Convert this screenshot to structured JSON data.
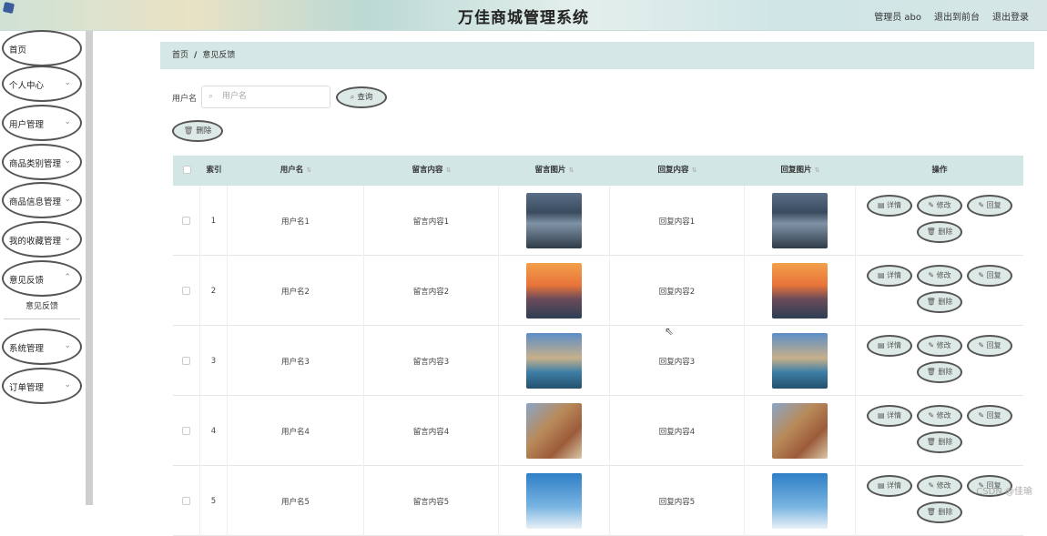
{
  "header": {
    "title": "万佳商城管理系统",
    "user": "管理员 abo",
    "back_to_front": "退出到前台",
    "logout": "退出登录"
  },
  "sidebar": {
    "items": [
      {
        "label": "首页",
        "chevron": false
      },
      {
        "label": "个人中心",
        "chevron": true
      },
      {
        "label": "用户管理",
        "chevron": true
      },
      {
        "label": "商品类别管理",
        "chevron": true
      },
      {
        "label": "商品信息管理",
        "chevron": true
      },
      {
        "label": "我的收藏管理",
        "chevron": true
      },
      {
        "label": "意见反馈",
        "chevron": true,
        "expanded": true
      },
      {
        "label": "系统管理",
        "chevron": true
      },
      {
        "label": "订单管理",
        "chevron": true
      }
    ],
    "sub_item": "意见反馈"
  },
  "breadcrumb": {
    "home": "首页",
    "sep": "/",
    "current": "意见反馈"
  },
  "search": {
    "label": "用户名",
    "placeholder": "用户名",
    "query_button": "查询",
    "delete_button": "删除"
  },
  "table": {
    "headers": [
      "索引",
      "用户名",
      "留言内容",
      "留言图片",
      "回复内容",
      "回复图片",
      "操作"
    ],
    "rows": [
      {
        "index": "1",
        "username": "用户名1",
        "message": "留言内容1",
        "reply": "回复内容1",
        "scene": "lake"
      },
      {
        "index": "2",
        "username": "用户名2",
        "message": "留言内容2",
        "reply": "回复内容2",
        "scene": "sunset"
      },
      {
        "index": "3",
        "username": "用户名3",
        "message": "留言内容3",
        "reply": "回复内容3",
        "scene": "castle"
      },
      {
        "index": "4",
        "username": "用户名4",
        "message": "留言内容4",
        "reply": "回复内容4",
        "scene": "cliff"
      },
      {
        "index": "5",
        "username": "用户名5",
        "message": "留言内容5",
        "reply": "回复内容5",
        "scene": "sky"
      }
    ],
    "actions": {
      "detail": "详情",
      "edit": "修改",
      "reply": "回复",
      "delete": "删除"
    }
  },
  "watermark": "CSDN @佳瑜",
  "colors": {
    "breadcrumb_bg": "#d5e7e6",
    "table_header_bg": "#d3e6e6",
    "pill_bg": "#dde9e6",
    "sidebar_scrollbar": "#cfcfcf"
  }
}
